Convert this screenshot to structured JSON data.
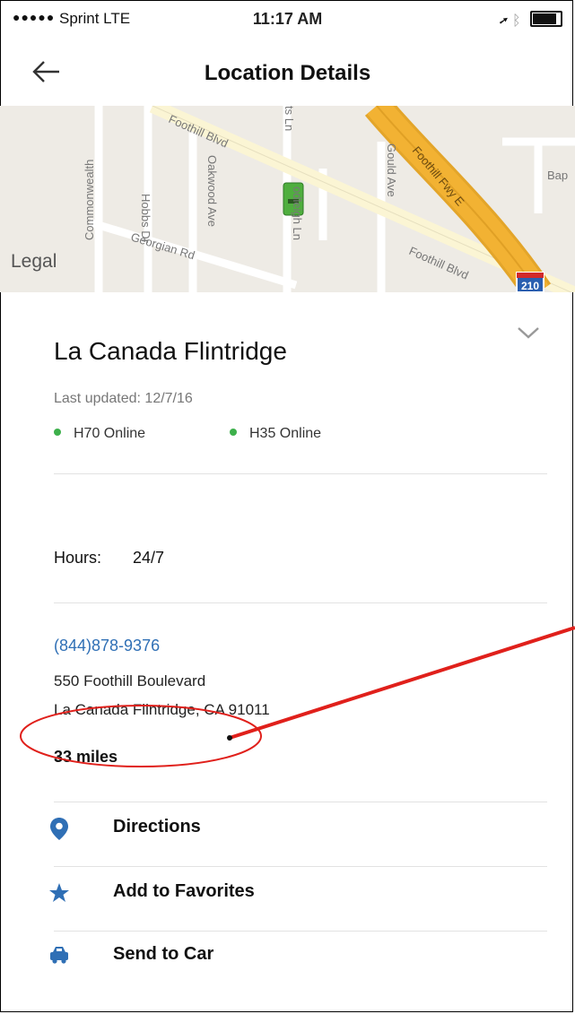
{
  "status_bar": {
    "carrier": "Sprint",
    "network": "LTE",
    "time": "11:17 AM"
  },
  "nav": {
    "title": "Location Details",
    "back_icon": "back-arrow-icon"
  },
  "map": {
    "legal_label": "Legal",
    "streets": [
      "Commonwealth",
      "Hobbs Dr",
      "Oakwood Ave",
      "Foothill Blvd",
      "Georgian Rd",
      "Gould Ave",
      "Foothill Fwy E",
      "Foothill Blvd",
      "Bap"
    ],
    "highway_shield": "210",
    "colors": {
      "freeway": "#f2b233",
      "road": "#fbf5d4",
      "marker": "#4fae3e"
    }
  },
  "location": {
    "name": "La Canada Flintridge",
    "last_updated": "Last updated: 12/7/16",
    "statuses": [
      {
        "label": "H70 Online"
      },
      {
        "label": "H35 Online"
      }
    ],
    "status_color": "#3db04b"
  },
  "hours": {
    "label": "Hours:",
    "value": "24/7"
  },
  "contact": {
    "phone": "(844)878-9376",
    "address_line1": "550 Foothill Boulevard",
    "address_line2": "La Canada Flintridge, CA 91011",
    "distance": "33 miles"
  },
  "actions": [
    {
      "label": "Directions",
      "icon": "location-pin-icon"
    },
    {
      "label": "Add to Favorites",
      "icon": "star-icon"
    },
    {
      "label": "Send to Car",
      "icon": "car-icon"
    }
  ],
  "accent_color": "#2f6fb5",
  "annotation_color": "#e0201b"
}
